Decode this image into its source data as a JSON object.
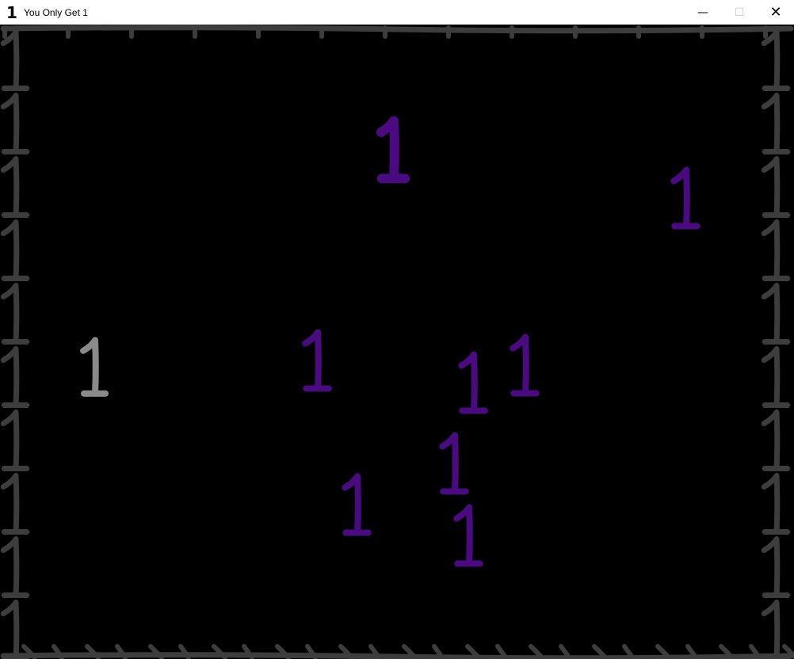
{
  "window": {
    "icon_glyph": "1",
    "title": "You Only Get 1",
    "minimize_glyph": "—",
    "maximize_glyph": "☐",
    "close_glyph": "✕"
  },
  "game": {
    "background": "#000000",
    "border_color": "#3d3d3d",
    "player": {
      "glyph": "1",
      "color": "#8a8a8a"
    },
    "enemy_color": "#4a0a80",
    "enemies": [
      {
        "glyph": "1",
        "variant": "bold"
      },
      {
        "glyph": "1",
        "variant": "normal"
      },
      {
        "glyph": "1",
        "variant": "normal"
      },
      {
        "glyph": "1",
        "variant": "normal"
      },
      {
        "glyph": "1",
        "variant": "normal"
      },
      {
        "glyph": "1",
        "variant": "normal"
      },
      {
        "glyph": "1",
        "variant": "normal"
      },
      {
        "glyph": "1",
        "variant": "normal"
      }
    ]
  }
}
